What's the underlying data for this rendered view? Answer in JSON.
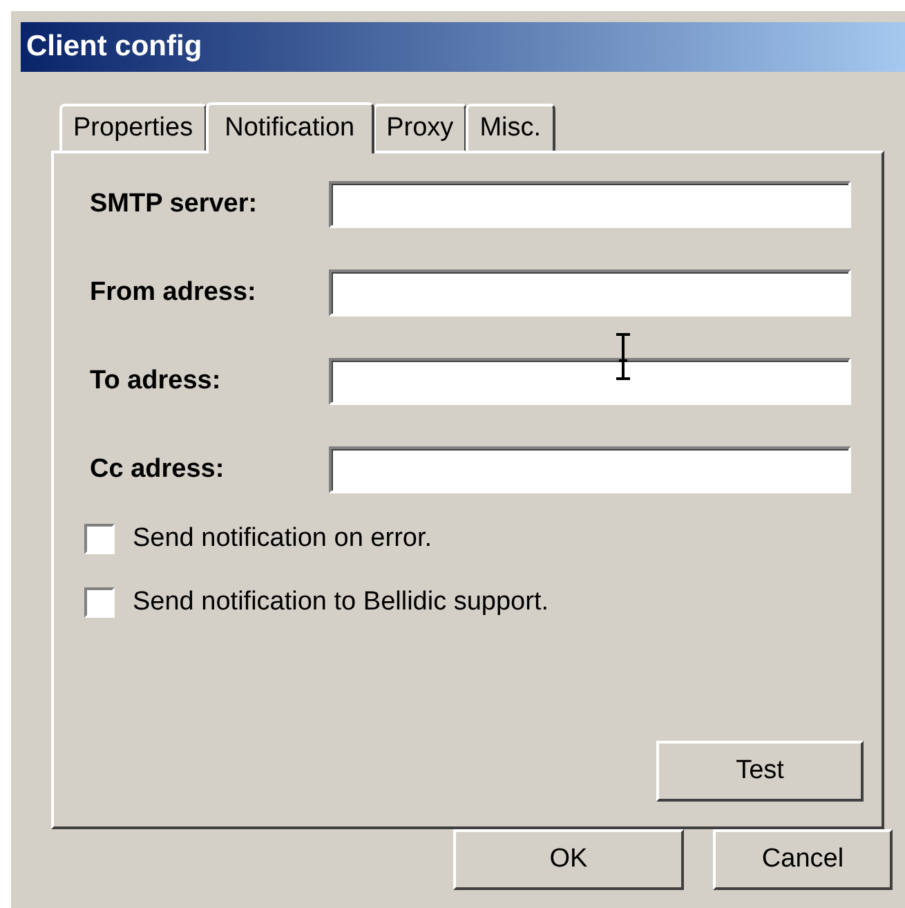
{
  "window": {
    "title": "Client config"
  },
  "tabs": [
    {
      "label": "Properties",
      "selected": false
    },
    {
      "label": "Notification",
      "selected": true
    },
    {
      "label": "Proxy",
      "selected": false
    },
    {
      "label": "Misc.",
      "selected": false
    }
  ],
  "fields": [
    {
      "label": "SMTP server:"
    },
    {
      "label": "From adress:"
    },
    {
      "label": "To adress:"
    },
    {
      "label": "Cc adress:"
    }
  ],
  "checkboxes": [
    {
      "label": "Send notification on error.",
      "checked": false
    },
    {
      "label": "Send notification to Bellidic support.",
      "checked": false
    }
  ],
  "test_button": "Test",
  "buttons": [
    "OK",
    "Cancel"
  ]
}
